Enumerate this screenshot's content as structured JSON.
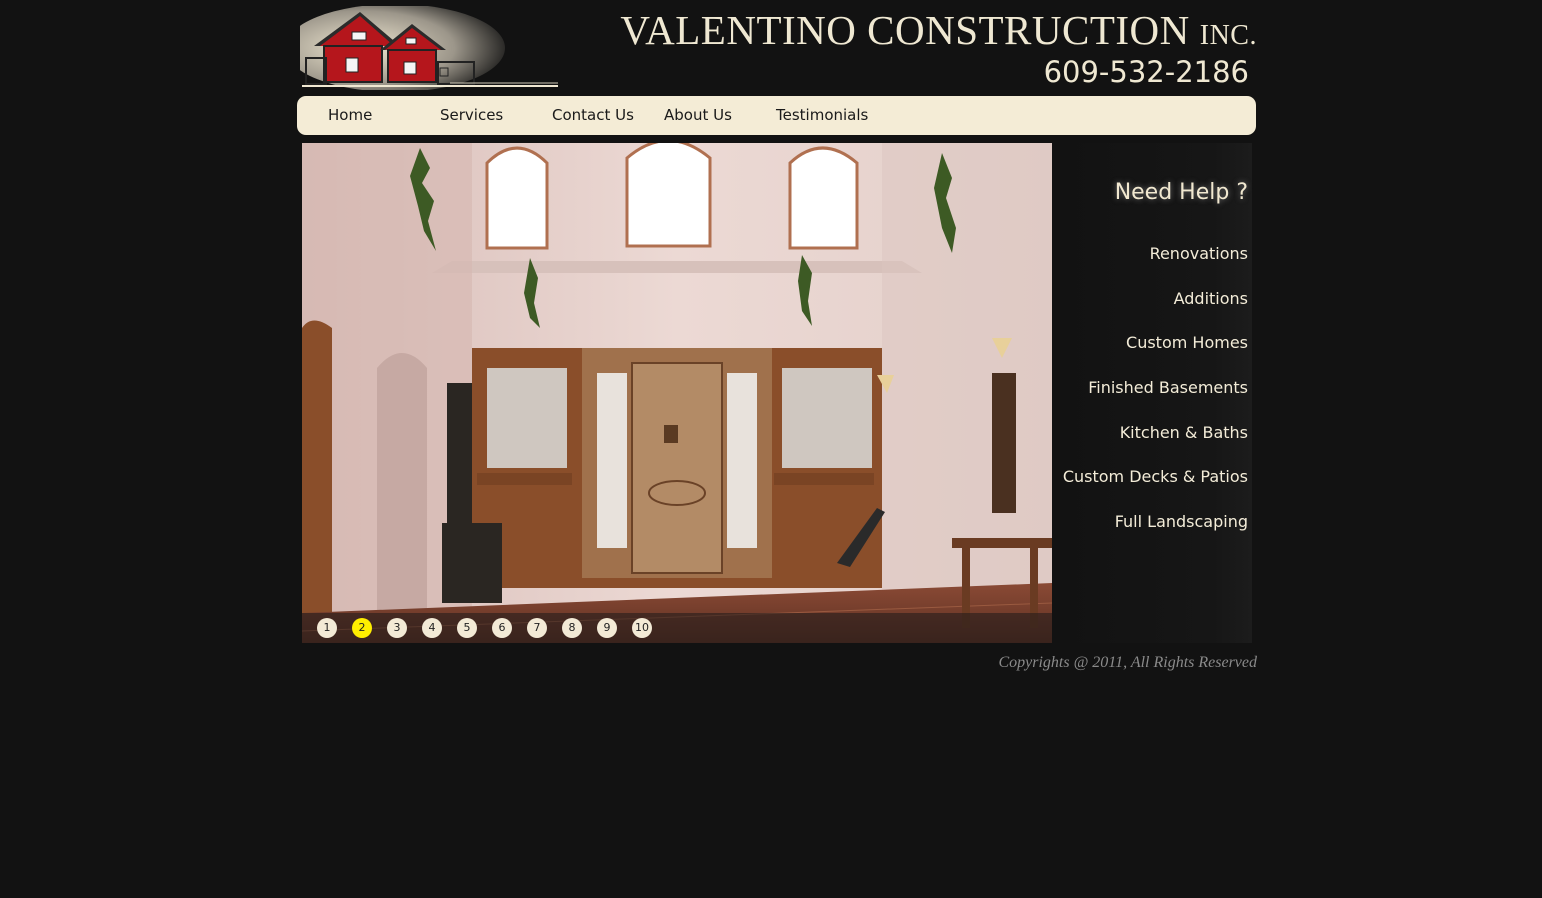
{
  "header": {
    "company_name": "VALENTINO CONSTRUCTION",
    "company_suffix": "INC.",
    "phone": "609-532-2186"
  },
  "nav": {
    "items": [
      {
        "label": "Home"
      },
      {
        "label": "Services"
      },
      {
        "label": "Contact Us"
      },
      {
        "label": "About Us"
      },
      {
        "label": "Testimonials"
      }
    ]
  },
  "slideshow": {
    "pages": [
      "1",
      "2",
      "3",
      "4",
      "5",
      "6",
      "7",
      "8",
      "9",
      "10"
    ],
    "active_page": "2"
  },
  "sidebar": {
    "title": "Need Help ?",
    "services": [
      {
        "label": "Renovations"
      },
      {
        "label": "Additions"
      },
      {
        "label": "Custom Homes"
      },
      {
        "label": "Finished Basements"
      },
      {
        "label": "Kitchen & Baths"
      },
      {
        "label": "Custom Decks & Patios"
      },
      {
        "label": "Full Landscaping"
      }
    ]
  },
  "footer": {
    "copyright": "Copyrights @ 2011, All Rights Reserved"
  },
  "colors": {
    "background": "#121212",
    "nav_bg": "#f4ecd6",
    "active_dot": "#ffee00",
    "logo_red": "#b5161c"
  }
}
